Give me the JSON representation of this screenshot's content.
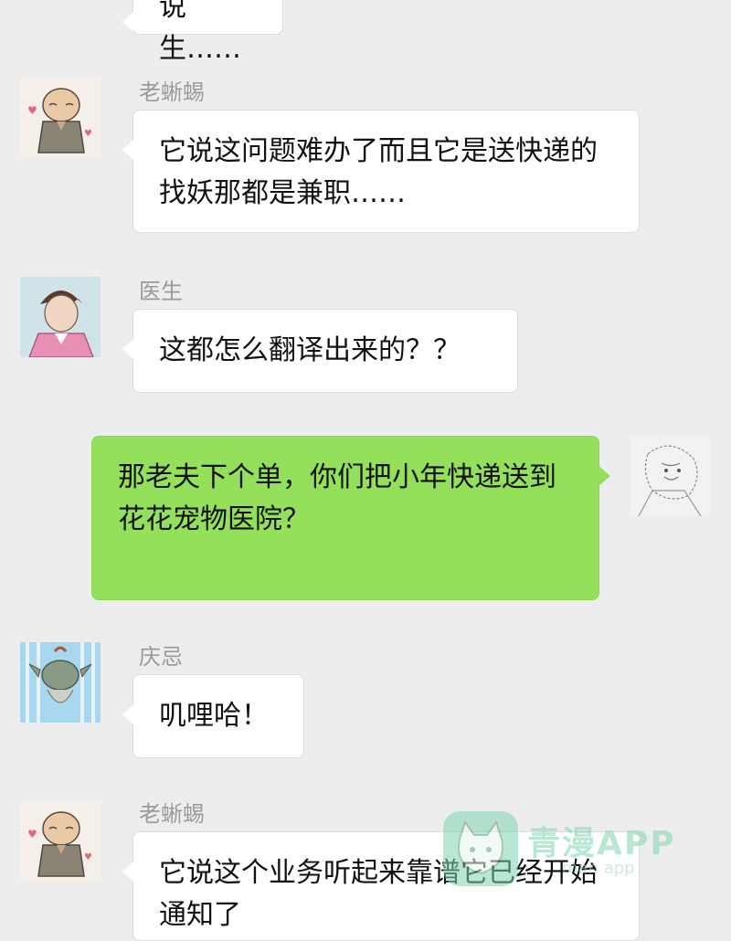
{
  "colors": {
    "background": "#ededed",
    "incoming_bubble": "#ffffff",
    "outgoing_bubble": "#95e05a",
    "name_text": "#9a9a9a"
  },
  "messages": [
    {
      "direction": "incoming",
      "text": "说生……"
    },
    {
      "direction": "incoming",
      "sender": "老蜥蜴",
      "avatar": "old-lizard-avatar-icon",
      "text": "它说这问题难办了而且它是送快递的找妖那都是兼职……"
    },
    {
      "direction": "incoming",
      "sender": "医生",
      "avatar": "doctor-avatar-icon",
      "text": "这都怎么翻译出来的？？"
    },
    {
      "direction": "outgoing",
      "avatar": "self-avatar-icon",
      "text": "那老夫下个单，你们把小年快递送到花花宠物医院？"
    },
    {
      "direction": "incoming",
      "sender": "庆忌",
      "avatar": "qingji-avatar-icon",
      "text": "叽哩哈！"
    },
    {
      "direction": "incoming",
      "sender": "老蜥蜴",
      "avatar": "old-lizard-avatar-icon",
      "text": "它说这个业务听起来靠谱它已经开始通知了"
    }
  ],
  "watermark": {
    "title": "青漫APP",
    "subtitle": "man app",
    "icon": "cat-logo-icon"
  }
}
